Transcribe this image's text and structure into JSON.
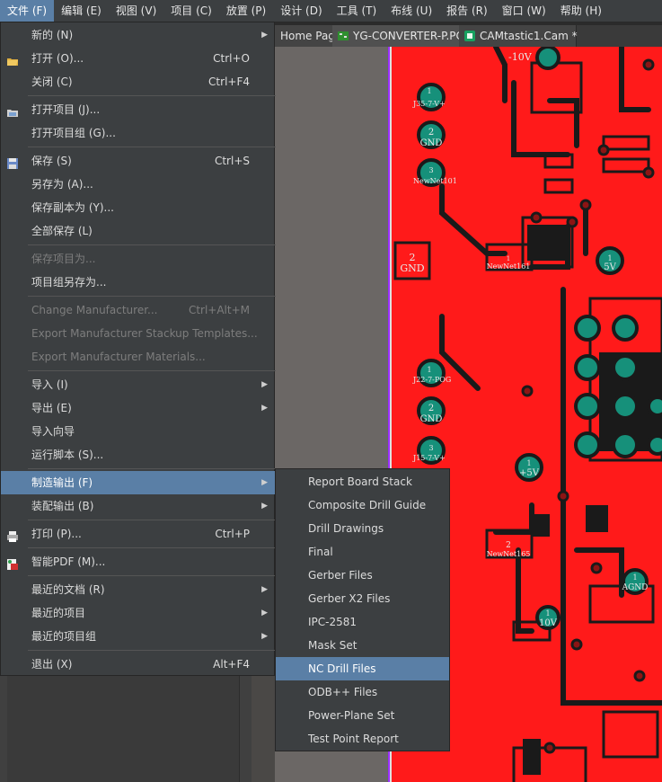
{
  "menubar": [
    {
      "label": "文件 (F)",
      "active": true
    },
    {
      "label": "编辑 (E)"
    },
    {
      "label": "视图 (V)"
    },
    {
      "label": "项目 (C)"
    },
    {
      "label": "放置 (P)"
    },
    {
      "label": "设计 (D)"
    },
    {
      "label": "工具 (T)"
    },
    {
      "label": "布线 (U)"
    },
    {
      "label": "报告 (R)"
    },
    {
      "label": "窗口 (W)"
    },
    {
      "label": "帮助 (H)"
    }
  ],
  "tabs": [
    {
      "label": "Home Page"
    },
    {
      "label": "YG-CONVERTER-P.PCB",
      "icon": "pcb-doc-icon"
    },
    {
      "label": "CAMtastic1.Cam *",
      "icon": "cam-doc-icon"
    }
  ],
  "file_menu": [
    {
      "label": "新的 (N)",
      "submenu": true
    },
    {
      "label": "打开 (O)...",
      "shortcut": "Ctrl+O",
      "icon": "open-folder-icon"
    },
    {
      "label": "关闭 (C)",
      "shortcut": "Ctrl+F4"
    },
    {
      "sep": true
    },
    {
      "label": "打开项目 (J)...",
      "icon": "open-project-icon"
    },
    {
      "label": "打开项目组 (G)..."
    },
    {
      "sep": true
    },
    {
      "label": "保存 (S)",
      "shortcut": "Ctrl+S",
      "icon": "save-icon"
    },
    {
      "label": "另存为 (A)..."
    },
    {
      "label": "保存副本为 (Y)..."
    },
    {
      "label": "全部保存 (L)"
    },
    {
      "sep": true
    },
    {
      "label": "保存项目为...",
      "disabled": true
    },
    {
      "label": "项目组另存为..."
    },
    {
      "sep": true
    },
    {
      "label": "Change Manufacturer...",
      "shortcut": "Ctrl+Alt+M",
      "disabled": true
    },
    {
      "label": "Export Manufacturer Stackup Templates...",
      "disabled": true
    },
    {
      "label": "Export Manufacturer Materials...",
      "disabled": true
    },
    {
      "sep": true
    },
    {
      "label": "导入 (I)",
      "submenu": true
    },
    {
      "label": "导出 (E)",
      "submenu": true
    },
    {
      "label": "导入向导"
    },
    {
      "label": "运行脚本 (S)..."
    },
    {
      "sep": true
    },
    {
      "label": "制造输出 (F)",
      "submenu": true,
      "active": true
    },
    {
      "label": "装配输出 (B)",
      "submenu": true
    },
    {
      "sep": true
    },
    {
      "label": "打印 (P)...",
      "shortcut": "Ctrl+P",
      "icon": "printer-icon"
    },
    {
      "sep": true
    },
    {
      "label": "智能PDF (M)...",
      "icon": "smart-pdf-icon"
    },
    {
      "sep": true
    },
    {
      "label": "最近的文档 (R)",
      "submenu": true
    },
    {
      "label": "最近的项目",
      "submenu": true
    },
    {
      "label": "最近的项目组",
      "submenu": true
    },
    {
      "sep": true
    },
    {
      "label": "退出 (X)",
      "shortcut": "Alt+F4"
    }
  ],
  "fab_submenu": [
    {
      "label": "Report Board Stack"
    },
    {
      "label": "Composite Drill Guide"
    },
    {
      "label": "Drill Drawings"
    },
    {
      "label": "Final"
    },
    {
      "label": "Gerber Files"
    },
    {
      "label": "Gerber X2 Files"
    },
    {
      "label": "IPC-2581"
    },
    {
      "label": "Mask Set"
    },
    {
      "label": "NC Drill Files",
      "active": true
    },
    {
      "label": "ODB++ Files"
    },
    {
      "label": "Power-Plane Set"
    },
    {
      "label": "Test Point Report"
    }
  ],
  "pcb_labels": {
    "l_neg10v": "-10V",
    "l_j35": "J35-7-V+",
    "l_gnd1": "GND",
    "l_newnet101": "NewNet101",
    "l_gnd_pad": "GND",
    "l_newnet161": "NewNet161",
    "l_5v": "5V",
    "l_j22": "J22-7-POG",
    "l_gnd2": "GND",
    "l_j15": "J15-7-V+",
    "l_plus5v": "+5V",
    "l_newnet165": "NewNet165",
    "l_agnd": "AGND",
    "l_10v": "10V",
    "n1": "1",
    "n2": "2",
    "n3": "3"
  },
  "colors": {
    "board": "#ff1a1a",
    "copper_pad": "#16907a",
    "track": "#1a1a1a",
    "menu_bg": "#3c3f41",
    "highlight": "#5a7fa6"
  }
}
